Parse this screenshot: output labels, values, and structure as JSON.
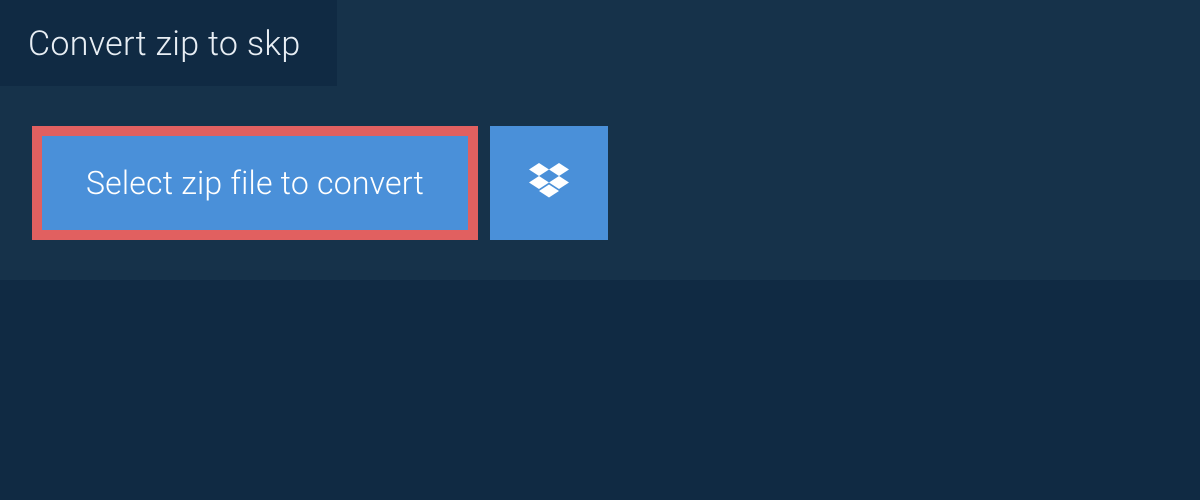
{
  "tab": {
    "label": "Convert zip to skp"
  },
  "actions": {
    "select_file_label": "Select zip file to convert",
    "dropbox_icon": "dropbox-icon"
  },
  "colors": {
    "page_bg": "#102a43",
    "panel_bg": "#16324a",
    "button_bg": "#4a90d9",
    "highlight_border": "#e16060",
    "text_light": "#e8eef4",
    "text_white": "#ffffff"
  }
}
